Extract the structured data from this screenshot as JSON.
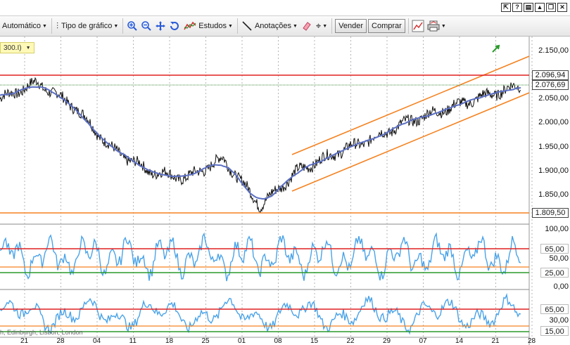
{
  "toolbar": {
    "period_label": "Automático",
    "chart_type_label": "Tipo de gráfico",
    "studies_label": "Estudos",
    "annotations_label": "Anotações",
    "sell_label": "Vender",
    "buy_label": "Comprar"
  },
  "chart": {
    "symbol_label": "300.I)",
    "price_axis_labels": [
      "2.150,00",
      "2.100,00",
      "2.050,00",
      "2.000,00",
      "1.950,00",
      "1.900,00",
      "1.850,00"
    ],
    "price_tags": {
      "resistance": "2.096,94",
      "last": "2.076,69",
      "support": "1.809,50"
    },
    "osc1": {
      "axis_top": "100,00",
      "axis_mid": "50,00",
      "axis_bottom": "0,00",
      "upper_tag": "65,00",
      "lower_tag": "25,00"
    },
    "osc2": {
      "upper_tag": "65,00",
      "mid_label": "30,00",
      "lower_tag": "15,00"
    },
    "footer_note": "h, Edinburgh, Lisbon, London",
    "date_labels": [
      "21",
      "28",
      "04",
      "11",
      "18",
      "25",
      "01",
      "08",
      "15",
      "22",
      "29",
      "07",
      "14",
      "21",
      "28"
    ],
    "colors": {
      "resistance": "#e02020",
      "channel": "#f58220",
      "price": "#111111",
      "moving_average": "#5b6fc4",
      "oscillator": "#4aa3e8",
      "green_line": "#2a9a2a"
    }
  },
  "chart_data": {
    "type": "line",
    "title": "",
    "xlabel": "",
    "ylabel": "",
    "ylim": [
      1800,
      2165
    ],
    "categories": [
      "21",
      "28",
      "04",
      "11",
      "18",
      "25",
      "01",
      "08",
      "15",
      "22",
      "29",
      "07",
      "14",
      "21",
      "28"
    ],
    "series": [
      {
        "values": [
          2045,
          2078,
          2030,
          1945,
          1900,
          1885,
          1925,
          1830,
          1900,
          1935,
          1965,
          2000,
          2025,
          2050,
          2072
        ]
      }
    ],
    "horizontal_lines": [
      2096.94,
      2076.69,
      1809.5
    ]
  }
}
